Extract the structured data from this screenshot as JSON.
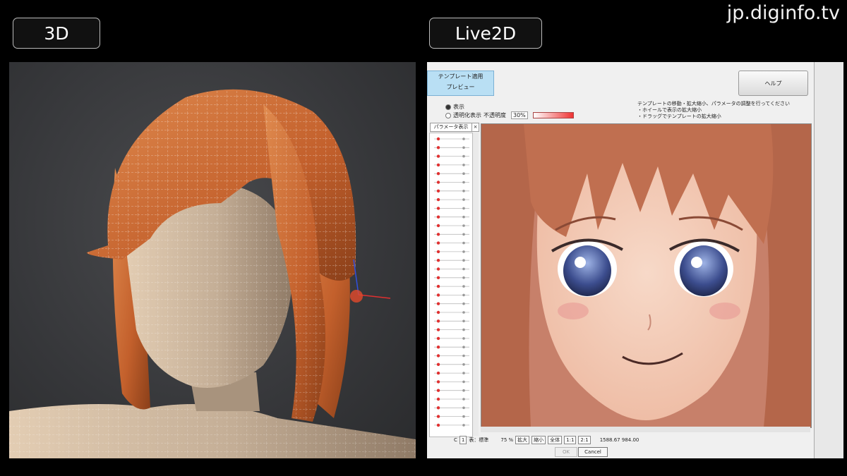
{
  "labels": {
    "left": "3D",
    "right": "Live2D",
    "watermark": "jp.diginfo.tv"
  },
  "live2d": {
    "template_button": [
      "テンプレート適用",
      "プレビュー"
    ],
    "help_button": "ヘルプ",
    "radio_options": [
      "表示",
      "透明化表示"
    ],
    "radio_extra": "不透明度",
    "opacity_value": "30%",
    "opacity_level": 0.3,
    "instructions": [
      "テンプレートの移動・拡大縮小、パラメータの調整を行ってください",
      "・ホイールで表示の拡大縮小",
      "・ドラッグでテンプレートの拡大縮小"
    ],
    "param_header": "パラメータ表示",
    "param_close": "×",
    "status": {
      "left_label": "C",
      "page": "1",
      "mode_text": "表：標準",
      "zoom": "75 %",
      "buttons": [
        "拡大",
        "縮小",
        "全体",
        "1:1",
        "2:1"
      ],
      "coords": "1588.67   984.00"
    },
    "ok": "OK",
    "cancel": "Cancel"
  },
  "colors": {
    "hair": "#c8632d",
    "skin3d": "#c9b39c",
    "accent_blue": "#b9dff4"
  }
}
